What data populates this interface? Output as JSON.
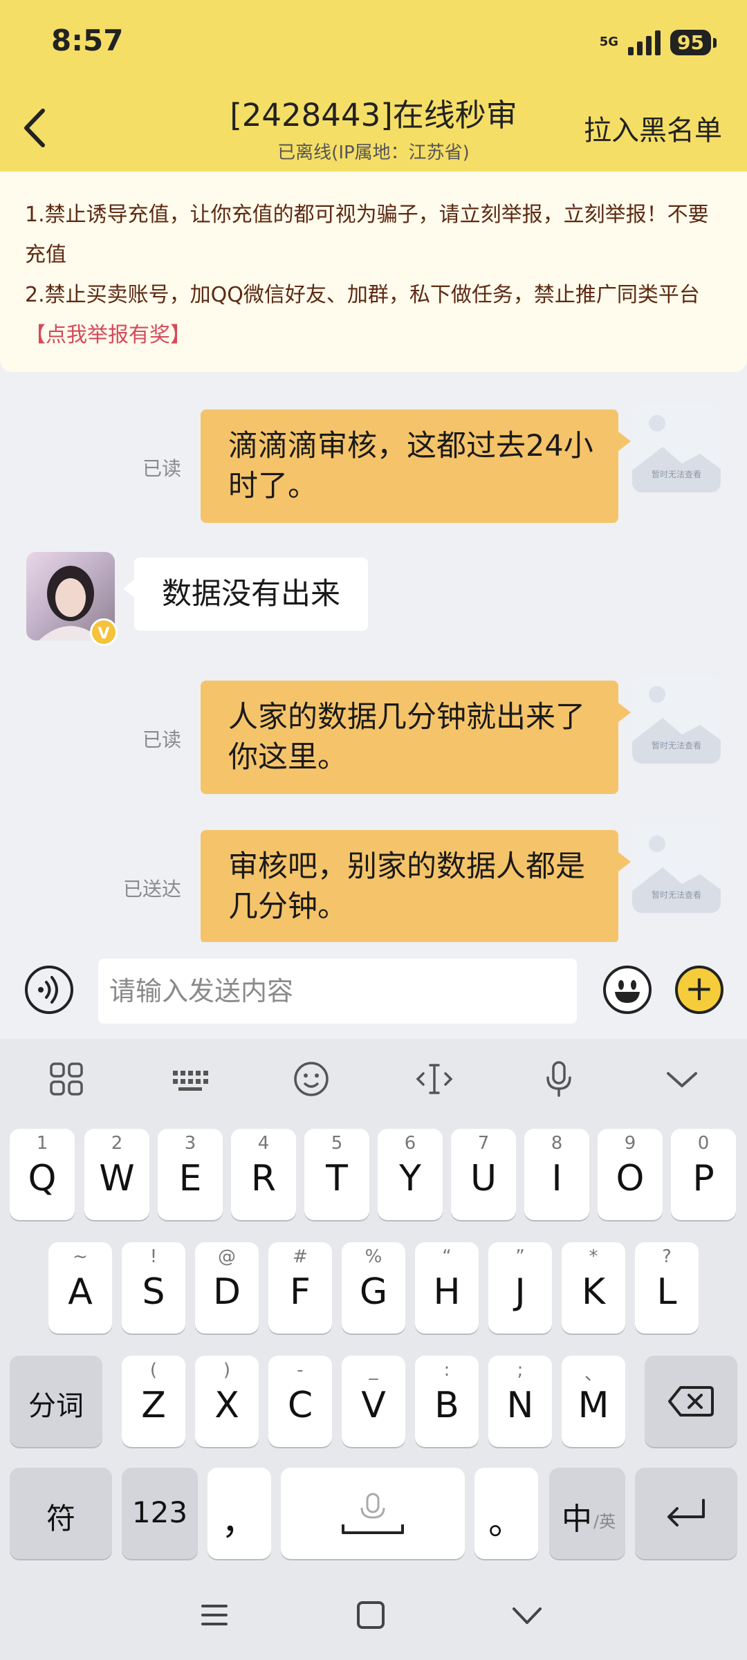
{
  "status_bar": {
    "time": "8:57",
    "network": "5G",
    "battery": "95"
  },
  "header": {
    "title": "[2428443]在线秒审",
    "subtitle": "已离线(IP属地：江苏省)",
    "blacklist_label": "拉入黑名单"
  },
  "notice": {
    "line1": "1.禁止诱导充值，让你充值的都可视为骗子，请立刻举报，立刻举报！不要充值",
    "line2": "2.禁止买卖账号，加QQ微信好友、加群，私下做任务，禁止推广同类平台",
    "report_link": "【点我举报有奖】"
  },
  "messages": [
    {
      "from": "me",
      "text": "滴滴滴审核，这都过去24小时了。",
      "status": "已读",
      "image_placeholder": "暂时无法查看"
    },
    {
      "from": "them",
      "text": "数据没有出来",
      "badge": "V"
    },
    {
      "from": "me",
      "text": "人家的数据几分钟就出来了你这里。",
      "status": "已读",
      "image_placeholder": "暂时无法查看"
    },
    {
      "from": "me",
      "text": "审核吧，别家的数据人都是几分钟。",
      "status": "已送达",
      "image_placeholder": "暂时无法查看"
    }
  ],
  "composer": {
    "placeholder": "请输入发送内容",
    "plus_symbol": "+"
  },
  "keyboard": {
    "row1": [
      {
        "main": "Q",
        "sub": "1"
      },
      {
        "main": "W",
        "sub": "2"
      },
      {
        "main": "E",
        "sub": "3"
      },
      {
        "main": "R",
        "sub": "4"
      },
      {
        "main": "T",
        "sub": "5"
      },
      {
        "main": "Y",
        "sub": "6"
      },
      {
        "main": "U",
        "sub": "7"
      },
      {
        "main": "I",
        "sub": "8"
      },
      {
        "main": "O",
        "sub": "9"
      },
      {
        "main": "P",
        "sub": "0"
      }
    ],
    "row2": [
      {
        "main": "A",
        "sub": "~"
      },
      {
        "main": "S",
        "sub": "!"
      },
      {
        "main": "D",
        "sub": "@"
      },
      {
        "main": "F",
        "sub": "#"
      },
      {
        "main": "G",
        "sub": "%"
      },
      {
        "main": "H",
        "sub": "“"
      },
      {
        "main": "J",
        "sub": "”"
      },
      {
        "main": "K",
        "sub": "*"
      },
      {
        "main": "L",
        "sub": "?"
      }
    ],
    "row3": [
      {
        "main": "Z",
        "sub": "("
      },
      {
        "main": "X",
        "sub": ")"
      },
      {
        "main": "C",
        "sub": "-"
      },
      {
        "main": "V",
        "sub": "_"
      },
      {
        "main": "B",
        "sub": ":"
      },
      {
        "main": "N",
        "sub": ";"
      },
      {
        "main": "M",
        "sub": "、"
      }
    ],
    "segment_label": "分词",
    "symbols_label": "符",
    "numbers_label": "123",
    "comma_label": "，",
    "period_label": "。",
    "lang_label": "中",
    "lang_sub": "/英"
  }
}
